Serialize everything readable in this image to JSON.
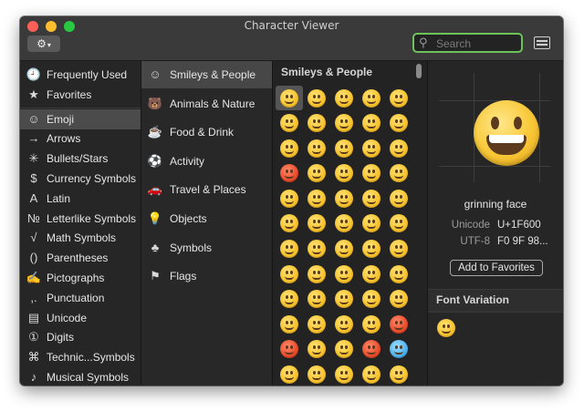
{
  "window": {
    "title": "Character Viewer"
  },
  "toolbar": {
    "gear_icon": "gear-icon",
    "search_placeholder": "Search",
    "layout_icon": "layout-icon"
  },
  "col1": {
    "top_items": [
      {
        "icon": "🕘",
        "label": "Frequently Used"
      },
      {
        "icon": "★",
        "label": "Favorites"
      }
    ],
    "items": [
      {
        "icon": "☺",
        "label": "Emoji",
        "selected": true
      },
      {
        "icon": "→",
        "label": "Arrows"
      },
      {
        "icon": "✳",
        "label": "Bullets/Stars"
      },
      {
        "icon": "$",
        "label": "Currency Symbols"
      },
      {
        "icon": "A",
        "label": "Latin"
      },
      {
        "icon": "№",
        "label": "Letterlike Symbols"
      },
      {
        "icon": "√",
        "label": "Math Symbols"
      },
      {
        "icon": "()",
        "label": "Parentheses"
      },
      {
        "icon": "✍",
        "label": "Pictographs"
      },
      {
        "icon": ",.",
        "label": "Punctuation"
      },
      {
        "icon": "▤",
        "label": "Unicode"
      },
      {
        "icon": "①",
        "label": "Digits"
      },
      {
        "icon": "⌘",
        "label": "Technic...Symbols"
      },
      {
        "icon": "♪",
        "label": "Musical Symbols"
      }
    ]
  },
  "col2": {
    "items": [
      {
        "icon": "☺",
        "label": "Smileys & People",
        "selected": true
      },
      {
        "icon": "🐻",
        "label": "Animals & Nature"
      },
      {
        "icon": "☕",
        "label": "Food & Drink"
      },
      {
        "icon": "⚽",
        "label": "Activity"
      },
      {
        "icon": "🚗",
        "label": "Travel & Places"
      },
      {
        "icon": "💡",
        "label": "Objects"
      },
      {
        "icon": "♣",
        "label": "Symbols"
      },
      {
        "icon": "⚑",
        "label": "Flags"
      }
    ]
  },
  "grid": {
    "header": "Smileys & People",
    "rows": [
      [
        "y",
        "y",
        "y",
        "y",
        "y"
      ],
      [
        "y",
        "y",
        "y",
        "y",
        "y"
      ],
      [
        "y",
        "y",
        "y",
        "y",
        "y"
      ],
      [
        "red",
        "y",
        "y",
        "y",
        "y"
      ],
      [
        "y",
        "y",
        "y",
        "y",
        "y"
      ],
      [
        "y",
        "y",
        "y",
        "y",
        "y"
      ],
      [
        "y",
        "y",
        "y",
        "y",
        "y"
      ],
      [
        "y",
        "y",
        "y",
        "y",
        "y"
      ],
      [
        "y",
        "y",
        "y",
        "y",
        "y"
      ],
      [
        "y",
        "y",
        "y",
        "y",
        "red"
      ],
      [
        "red",
        "y",
        "y",
        "red",
        "blue"
      ],
      [
        "y",
        "y",
        "y",
        "y",
        "y"
      ]
    ],
    "selected_index": 0
  },
  "detail": {
    "char_name": "grinning face",
    "unicode_label": "Unicode",
    "unicode_value": "U+1F600",
    "utf8_label": "UTF-8",
    "utf8_value": "F0 9F 98...",
    "add_favorites": "Add to Favorites",
    "font_variation_header": "Font Variation"
  }
}
